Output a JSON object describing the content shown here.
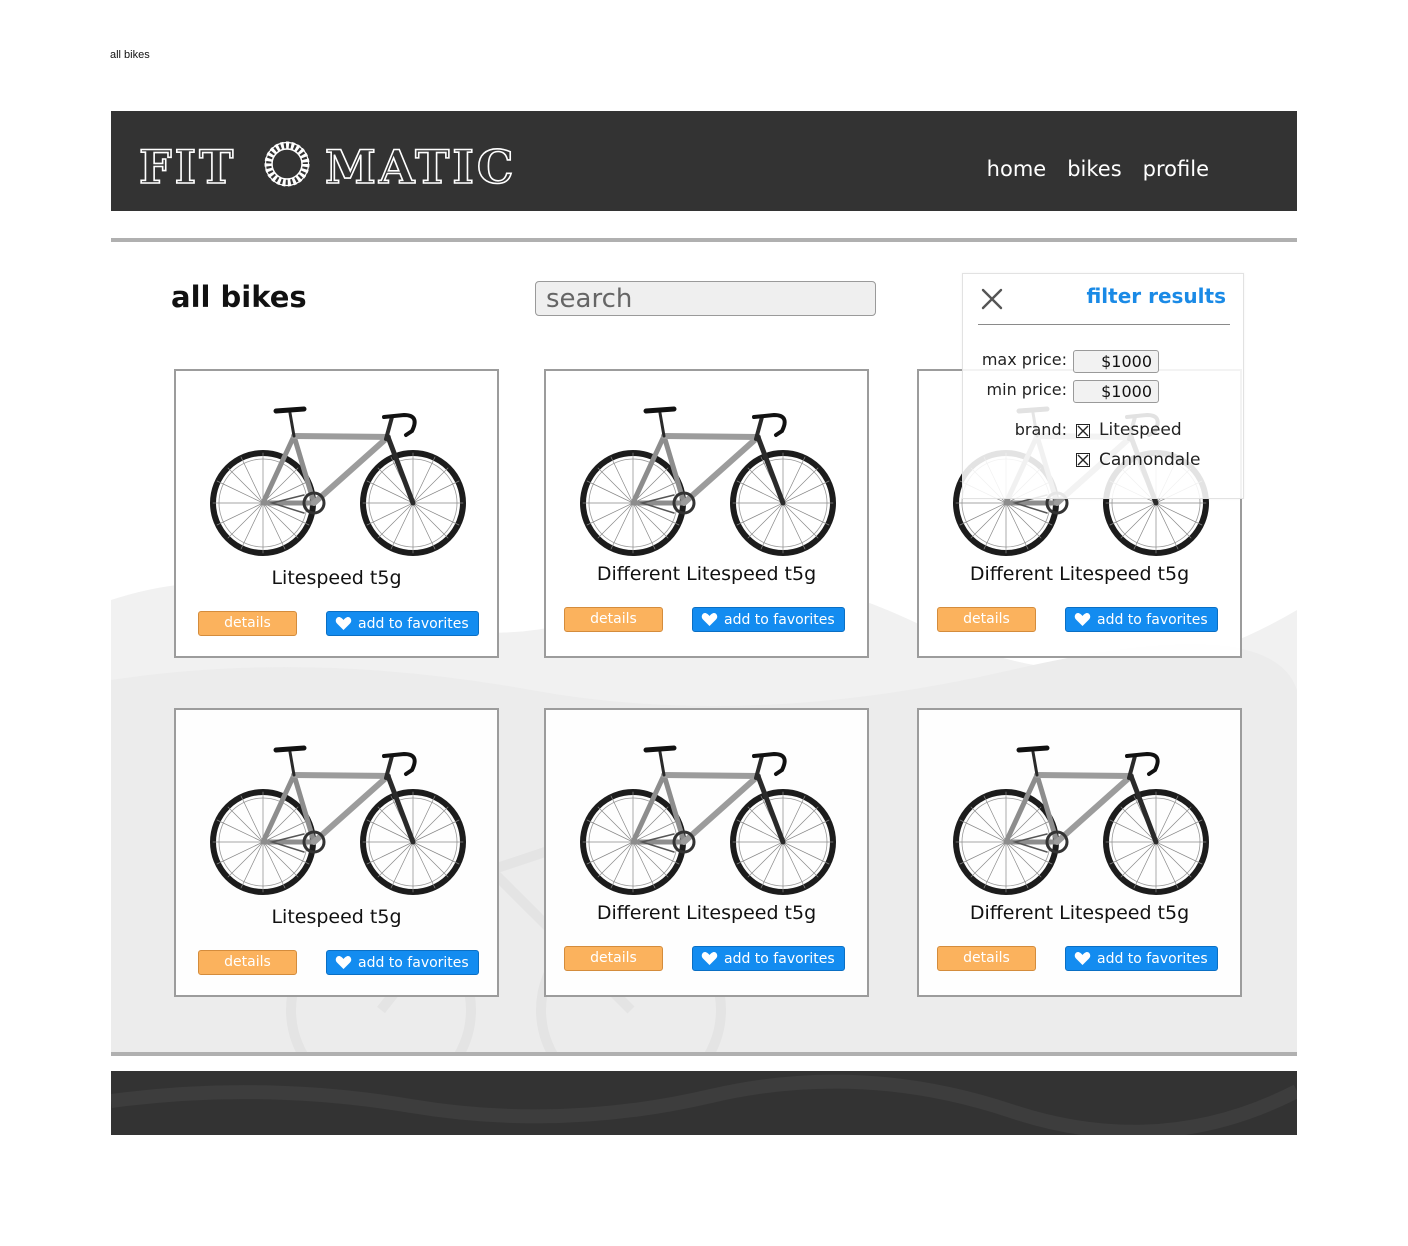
{
  "page_caption": "all bikes",
  "brand": {
    "logo_text_left": "FIT",
    "logo_text_right": "MATIC"
  },
  "nav": {
    "items": [
      "home",
      "bikes",
      "profile"
    ]
  },
  "page_title": "all bikes",
  "search": {
    "placeholder": "search",
    "value": ""
  },
  "cards": [
    {
      "title": "Litespeed t5g",
      "details_label": "details",
      "favorite_label": "add to favorites"
    },
    {
      "title": "Different Litespeed t5g",
      "details_label": "details",
      "favorite_label": "add to favorites"
    },
    {
      "title": "Different Litespeed t5g",
      "details_label": "details",
      "favorite_label": "add to favorites"
    },
    {
      "title": "Litespeed t5g",
      "details_label": "details",
      "favorite_label": "add to favorites"
    },
    {
      "title": "Different Litespeed t5g",
      "details_label": "details",
      "favorite_label": "add to favorites"
    },
    {
      "title": "Different Litespeed t5g",
      "details_label": "details",
      "favorite_label": "add to favorites"
    }
  ],
  "filter": {
    "title": "filter results",
    "max_price_label": "max price:",
    "max_price_value": "$1000",
    "min_price_label": "min price:",
    "min_price_value": "$1000",
    "brand_label": "brand:",
    "brands": [
      {
        "name": "Litespeed",
        "checked": true
      },
      {
        "name": "Cannondale",
        "checked": true
      }
    ]
  },
  "colors": {
    "header_bg": "#333333",
    "details_button": "#fbb25d",
    "favorite_button": "#138cf0",
    "filter_title": "#1a8ae6",
    "rule": "#b0b0b0"
  },
  "icons": {
    "logo_mark": "chainring-icon",
    "close": "close-icon",
    "favorite": "heart-icon",
    "checkbox": "checkbox-checked-icon",
    "product_image": "road-bike-image"
  }
}
